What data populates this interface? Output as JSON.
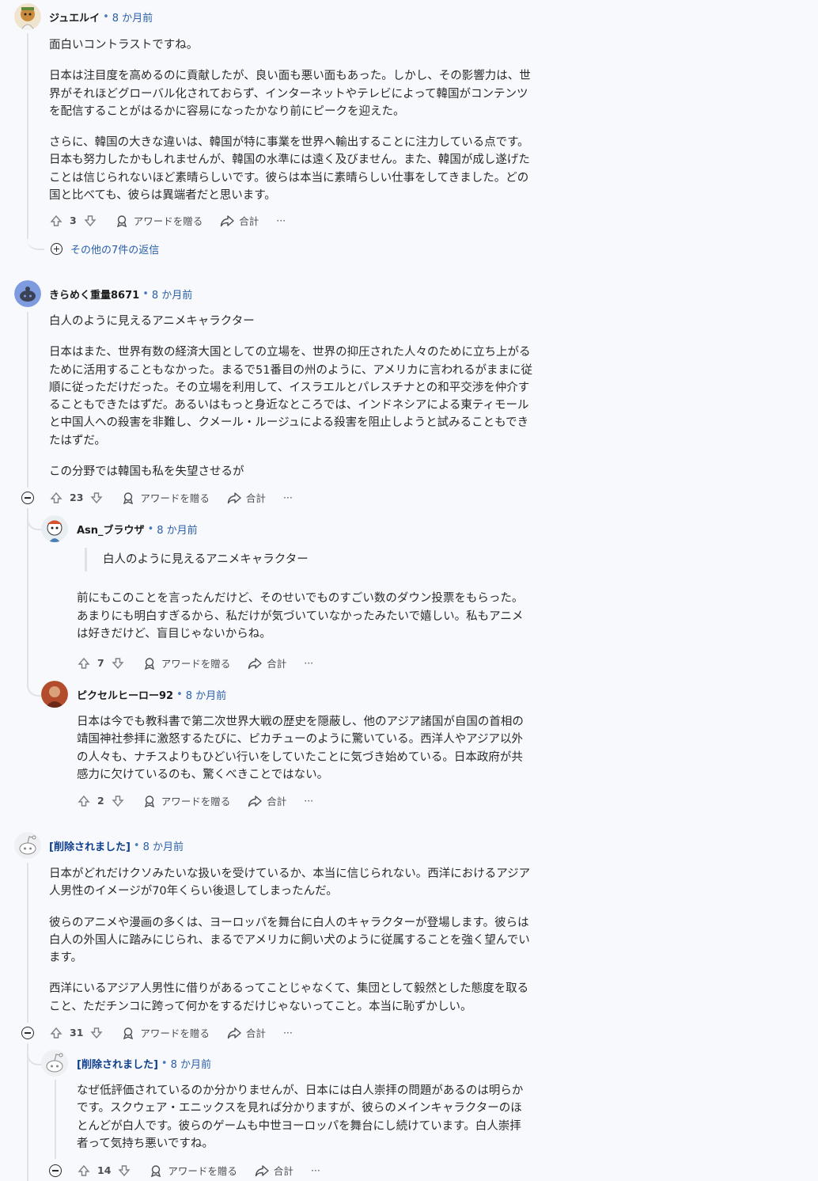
{
  "actions": {
    "award": "アワードを贈る",
    "share": "合計",
    "more": "···"
  },
  "thread": {
    "c1": {
      "author": "ジュエルイ",
      "time": "8 か月前",
      "p1": "面白いコントラストですね。",
      "p2": "日本は注目度を高めるのに貢献したが、良い面も悪い面もあった。しかし、その影響力は、世界がそれほどグローバル化されておらず、インターネットやテレビによって韓国がコンテンツを配信することがはるかに容易になったかなり前にピークを迎えた。",
      "p3": "さらに、韓国の大きな違いは、韓国が特に事業を世界へ輸出することに注力している点です。日本も努力したかもしれませんが、韓国の水準には遠く及びません。また、韓国が成し遂げたことは信じられないほど素晴らしいです。彼らは本当に素晴らしい仕事をしてきました。どの国と比べても、彼らは異端者だと思います。",
      "votes": "3",
      "more_replies": "その他の7件の返信"
    },
    "c2": {
      "author": "きらめく重量8671",
      "time": "8 か月前",
      "p1": "白人のように見えるアニメキャラクター",
      "p2": "日本はまた、世界有数の経済大国としての立場を、世界の抑圧された人々のために立ち上がるために活用することもなかった。まるで51番目の州のように、アメリカに言われるがままに従順に従っただけだった。その立場を利用して、イスラエルとパレスチナとの和平交渉を仲介することもできたはずだ。あるいはもっと身近なところでは、インドネシアによる東ティモールと中国人への殺害を非難し、クメール・ルージュによる殺害を阻止しようと試みることもできたはずだ。",
      "p3": "この分野では韓国も私を失望させるが",
      "votes": "23"
    },
    "c3": {
      "author": "Asn_ブラウザ",
      "time": "8 か月前",
      "quote": "白人のように見えるアニメキャラクター",
      "p1": "前にもこのことを言ったんだけど、そのせいでものすごい数のダウン投票をもらった。あまりにも明白すぎるから、私だけが気づいていなかったみたいで嬉しい。私もアニメは好きだけど、盲目じゃないからね。",
      "votes": "7"
    },
    "c4": {
      "author": "ピクセルヒーロー92",
      "time": "8 か月前",
      "p1": "日本は今でも教科書で第二次世界大戦の歴史を隠蔽し、他のアジア諸国が自国の首相の靖国神社参拝に激怒するたびに、ピカチューのように驚いている。西洋人やアジア以外の人々も、ナチスよりもひどい行いをしていたことに気づき始めている。日本政府が共感力に欠けているのも、驚くべきことではない。",
      "votes": "2"
    },
    "c5": {
      "author": "[削除されました]",
      "time": "8 か月前",
      "p1": "日本がどれだけクソみたいな扱いを受けているか、本当に信じられない。西洋におけるアジア人男性のイメージが70年くらい後退してしまったんだ。",
      "p2": "彼らのアニメや漫画の多くは、ヨーロッパを舞台に白人のキャラクターが登場します。彼らは白人の外国人に踏みにじられ、まるでアメリカに飼い犬のように従属することを強く望んでいます。",
      "p3": "西洋にいるアジア人男性に借りがあるってことじゃなくて、集団として毅然とした態度を取ること、ただチンコに跨って何かをするだけじゃないってこと。本当に恥ずかしい。",
      "votes": "31"
    },
    "c6": {
      "author": "[削除されました]",
      "time": "8 か月前",
      "p1": "なぜ低評価されているのか分かりませんが、日本には白人崇拝の問題があるのは明らかです。スクウェア・エニックスを見れば分かりますが、彼らのメインキャラクターのほとんどが白人です。彼らのゲームも中世ヨーロッパを舞台にし続けています。白人崇拝者って気持ち悪いですね。",
      "votes": "14"
    }
  },
  "colors": {
    "link": "#2a5fa8",
    "thread_line": "#dfe3e8",
    "background": "#f7f9fc"
  },
  "icons": [
    "upvote-icon",
    "downvote-icon",
    "award-icon",
    "share-icon",
    "collapse-icon",
    "expand-icon"
  ]
}
